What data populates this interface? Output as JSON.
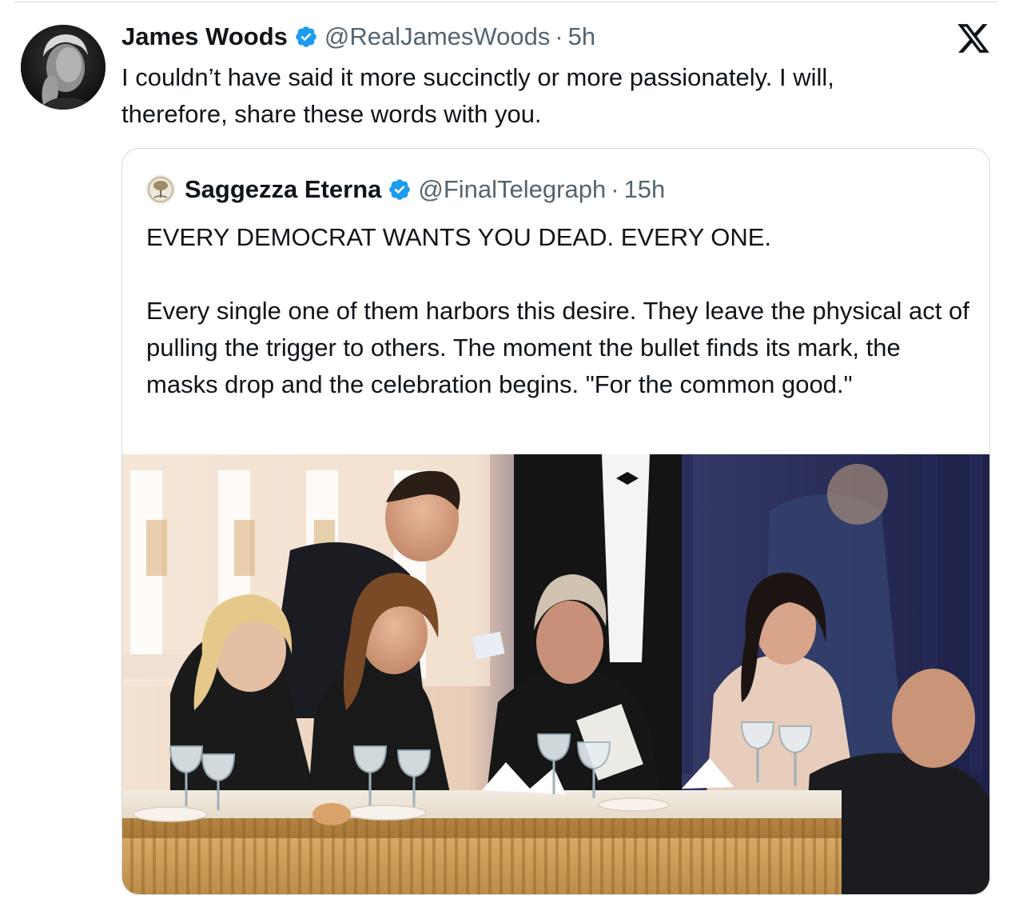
{
  "tweet": {
    "author_name": "James Woods",
    "author_handle": "@RealJamesWoods",
    "separator": "·",
    "time": "5h",
    "verified_icon": "verified-badge-icon",
    "text": "I couldn’t have said it more succinctly or more passionately. I will, therefore, share these words with you."
  },
  "platform_icon": "x-logo-icon",
  "quoted_tweet": {
    "author_name": "Saggezza Eterna",
    "author_handle": "@FinalTelegraph",
    "separator": "·",
    "time": "15h",
    "verified_icon": "verified-badge-icon",
    "text_paragraphs": [
      "EVERY DEMOCRAT WANTS YOU DEAD. EVERY ONE.",
      "Every single one of them harbors this desire. They leave the physical act of pulling the trigger to others. The moment the bullet finds its mark, the masks drop and the celebration begins. \"For the common good.\""
    ]
  },
  "colors": {
    "text_primary": "#0f1419",
    "text_secondary": "#536471",
    "verified_blue": "#1d9bf0",
    "border": "#cfd9de"
  }
}
